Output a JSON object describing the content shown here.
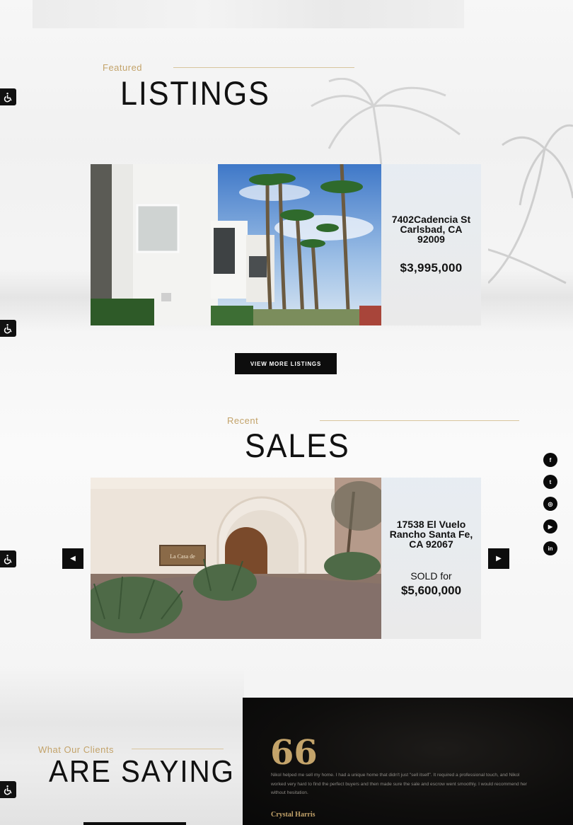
{
  "listings": {
    "eyebrow": "Featured",
    "heading": "LISTINGS",
    "card": {
      "address": "7402Cadencia St Carlsbad, CA 92009",
      "price": "$3,995,000"
    },
    "button_label": "VIEW MORE LISTINGS"
  },
  "sales": {
    "eyebrow": "Recent",
    "heading": "SALES",
    "card": {
      "address": "17538 El Vuelo Rancho Santa Fe, CA 92067",
      "status": "SOLD for",
      "price": "$5,600,000",
      "sign_text": "La Casa de"
    },
    "prev_icon": "chevron-left-icon",
    "next_icon": "chevron-right-icon"
  },
  "social": [
    {
      "icon": "facebook-icon",
      "glyph": "f"
    },
    {
      "icon": "twitter-icon",
      "glyph": "t"
    },
    {
      "icon": "instagram-icon",
      "glyph": "◎"
    },
    {
      "icon": "youtube-icon",
      "glyph": "▶"
    },
    {
      "icon": "linkedin-icon",
      "glyph": "in"
    }
  ],
  "testimonials": {
    "eyebrow": "What Our Clients",
    "heading": "ARE SAYING",
    "quote_glyph": "66",
    "quote": "Nikol helped me sell my home. I had a unique home that didn't just \"sell itself\". It required a professional touch, and Nikol worked very hard to find the perfect buyers and then made sure the sale and escrow went smoothly. I would recommend her without hesitation.",
    "author": "Crystal Harris"
  },
  "accessibility_icon": "wheelchair-icon",
  "colors": {
    "accent_gold": "#c3a36a",
    "dark": "#0d0d0d"
  }
}
